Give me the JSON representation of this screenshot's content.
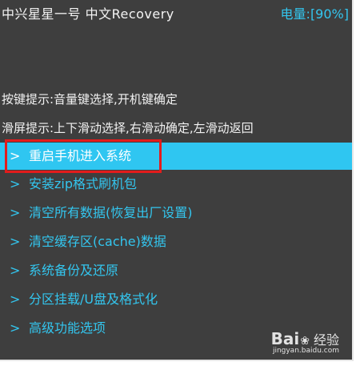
{
  "header": {
    "title": "中兴星星一号  中文Recovery",
    "battery": "电量:[90%]"
  },
  "tips": {
    "key_tip": "按键提示:音量键选择,开机键确定",
    "swipe_tip": "滑屏提示:上下滑动选择,右滑动确定,左滑动返回"
  },
  "menu": {
    "arrow": ">",
    "items": [
      {
        "label": "重启手机进入系统"
      },
      {
        "label": "安装zip格式刷机包"
      },
      {
        "label": "清空所有数据(恢复出厂设置)"
      },
      {
        "label": "清空缓存区(cache)数据"
      },
      {
        "label": "系统备份及还原"
      },
      {
        "label": "分区挂载/U盘及格式化"
      },
      {
        "label": "高级功能选项"
      }
    ],
    "selected_index": 0
  },
  "watermark": {
    "logo": "Bai",
    "logo_tail": "百",
    "text": "经验",
    "url": "jingyan.baidu.com"
  },
  "colors": {
    "background": "#3e3e3e",
    "accent": "#2fc6f1",
    "highlight_box": "#e31c1c"
  }
}
